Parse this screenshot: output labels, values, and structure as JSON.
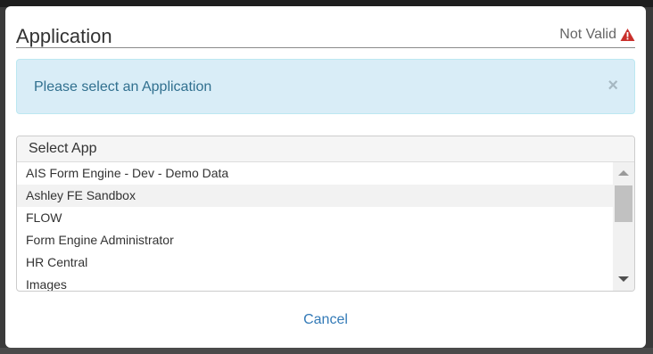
{
  "dialog": {
    "title": "Application",
    "status_text": "Not Valid",
    "status_icon": "warning-triangle-icon",
    "status_icon_color": "#c9302c"
  },
  "alert": {
    "message": "Please select an Application",
    "close_glyph": "×",
    "background": "#d9edf7",
    "text_color": "#31708f"
  },
  "select_app": {
    "header": "Select App",
    "items": [
      {
        "label": "AIS Form Engine - Dev - Demo Data"
      },
      {
        "label": "Ashley FE Sandbox"
      },
      {
        "label": "FLOW"
      },
      {
        "label": "Form Engine Administrator"
      },
      {
        "label": "HR Central"
      },
      {
        "label": "Images"
      }
    ]
  },
  "footer": {
    "cancel_label": "Cancel",
    "link_color": "#337ab7"
  }
}
